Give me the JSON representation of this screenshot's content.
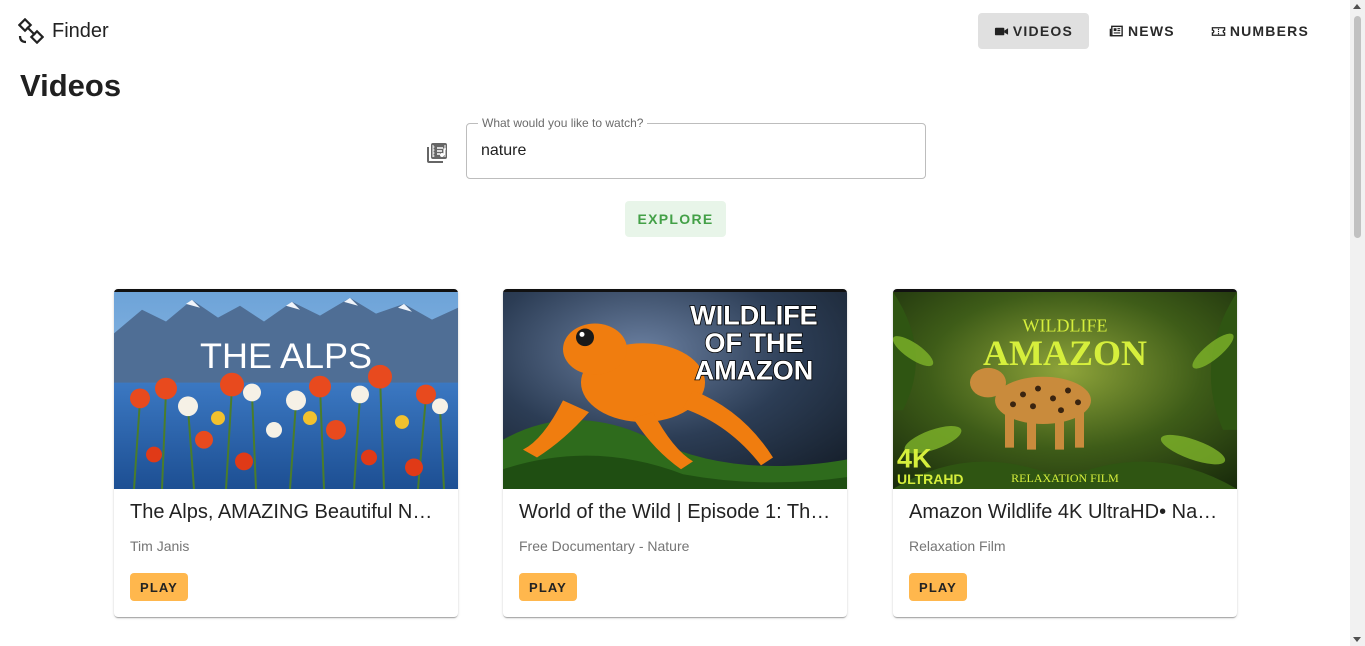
{
  "header": {
    "brand": "Finder",
    "nav": [
      {
        "label": "VIDEOS",
        "icon": "video-camera-icon",
        "active": true
      },
      {
        "label": "NEWS",
        "icon": "newspaper-icon",
        "active": false
      },
      {
        "label": "NUMBERS",
        "icon": "ticket-icon",
        "active": false
      }
    ]
  },
  "page": {
    "title": "Videos"
  },
  "search": {
    "label": "What would you like to watch?",
    "value": "nature",
    "icon": "video-library-icon"
  },
  "explore_label": "EXPLORE",
  "videos": [
    {
      "title": "The Alps, AMAZING Beautiful N…",
      "channel": "Tim Janis",
      "play_label": "PLAY",
      "thumb_text": "THE ALPS"
    },
    {
      "title": "World of the Wild | Episode 1: Th…",
      "channel": "Free Documentary - Nature",
      "play_label": "PLAY",
      "thumb_lines": [
        "WILDLIFE",
        "OF THE",
        "AMAZON"
      ]
    },
    {
      "title": "Amazon Wildlife 4K UltraHD• Na…",
      "channel": "Relaxation Film",
      "play_label": "PLAY",
      "thumb_top": "WILDLIFE",
      "thumb_main": "AMAZON",
      "thumb_4k": "4K",
      "thumb_uhd": "ULTRAHD",
      "thumb_footer": "RELAXATION FILM"
    }
  ],
  "colors": {
    "accent_green": "#43a047",
    "play_button": "#ffb74d",
    "nav_active": "#e0e0e0"
  }
}
